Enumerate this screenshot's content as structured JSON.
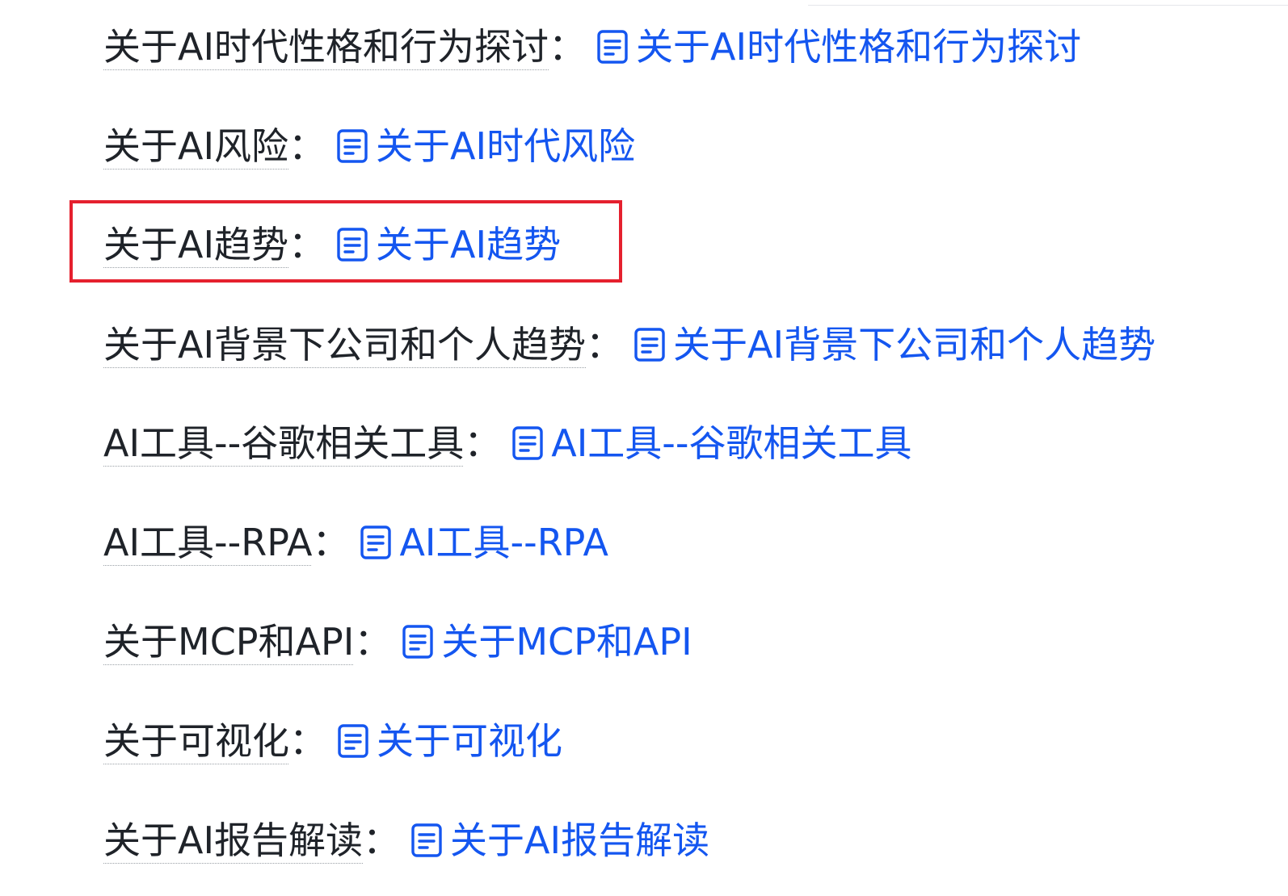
{
  "separator": "：",
  "colors": {
    "link": "#1456f0",
    "text": "#1f2329",
    "highlight": "#e5202e"
  },
  "items": [
    {
      "label": "关于AI时代性格和行为探讨",
      "link": "关于AI时代性格和行为探讨",
      "icon": "document-icon"
    },
    {
      "label": "关于AI风险",
      "link": "关于AI时代风险",
      "icon": "document-icon"
    },
    {
      "label": "关于AI趋势",
      "link": "关于AI趋势",
      "icon": "document-icon",
      "highlighted": true
    },
    {
      "label": "关于AI背景下公司和个人趋势",
      "link": "关于AI背景下公司和个人趋势",
      "icon": "document-icon"
    },
    {
      "label": "AI工具--谷歌相关工具",
      "link": "AI工具--谷歌相关工具",
      "icon": "document-icon"
    },
    {
      "label": "AI工具--RPA",
      "link": "AI工具--RPA",
      "icon": "document-icon"
    },
    {
      "label": "关于MCP和API",
      "link": "关于MCP和API",
      "icon": "document-icon"
    },
    {
      "label": "关于可视化",
      "link": "关于可视化",
      "icon": "document-icon"
    },
    {
      "label": "关于AI报告解读",
      "link": "关于AI报告解读",
      "icon": "document-icon"
    }
  ]
}
